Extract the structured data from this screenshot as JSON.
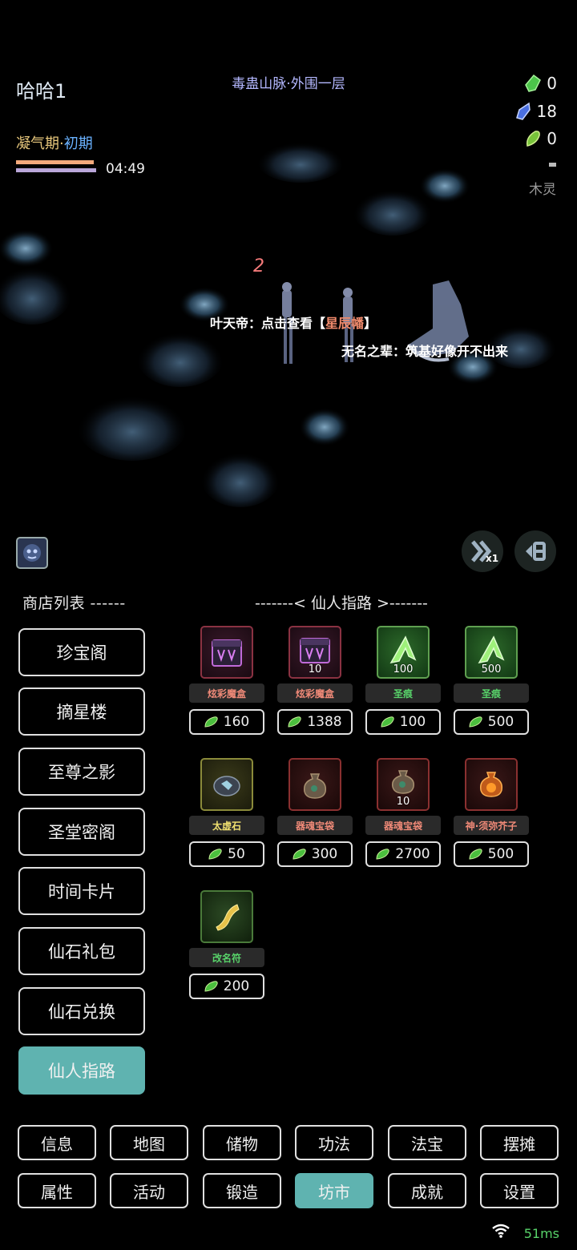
{
  "hud": {
    "player_name": "哈哈1",
    "location": "毒蛊山脉·外围一层",
    "realm": "凝气期",
    "realm_sep": "·",
    "realm_stage": "初期",
    "timer": "04:49",
    "currencies": [
      {
        "icon": "green-spirit-stone-icon",
        "value": "0"
      },
      {
        "icon": "blue-spirit-stone-icon",
        "value": "18"
      },
      {
        "icon": "green-leaf-stone-icon",
        "value": "0"
      }
    ],
    "spirit_root": "木灵"
  },
  "scene": {
    "damage_number": "2",
    "chat1_prefix": "叶天帝：点击查看【",
    "chat1_item": "星辰幡",
    "chat1_suffix": "】",
    "chat2": "无名之辈：筑基好像开不出来"
  },
  "controls": {
    "speed_label": "x1"
  },
  "shop": {
    "list_title": "商店列表 ------",
    "panel_title": "-------< 仙人指路 >-------",
    "shops": [
      "珍宝阁",
      "摘星楼",
      "至尊之影",
      "圣堂密阁",
      "时间卡片",
      "仙石礼包",
      "仙石兑换",
      "仙人指路"
    ],
    "active_shop": "仙人指路",
    "items": [
      {
        "name": "炫彩魔盒",
        "qty": "",
        "price": "160",
        "name_color": "#f08a78"
      },
      {
        "name": "炫彩魔盒",
        "qty": "10",
        "price": "1388",
        "name_color": "#f08a78"
      },
      {
        "name": "圣痕",
        "qty": "100",
        "price": "100",
        "name_color": "#58d36a"
      },
      {
        "name": "圣痕",
        "qty": "500",
        "price": "500",
        "name_color": "#58d36a"
      },
      {
        "name": "太虚石",
        "qty": "",
        "price": "50",
        "name_color": "#f0e070"
      },
      {
        "name": "器魂宝袋",
        "qty": "",
        "price": "300",
        "name_color": "#f08a78"
      },
      {
        "name": "器魂宝袋",
        "qty": "10",
        "price": "2700",
        "name_color": "#f08a78"
      },
      {
        "name": "神·须弥芥子",
        "qty": "",
        "price": "500",
        "name_color": "#f08a78"
      },
      {
        "name": "改名符",
        "qty": "",
        "price": "200",
        "name_color": "#58d36a"
      }
    ]
  },
  "nav": {
    "row1": [
      "信息",
      "地图",
      "储物",
      "功法",
      "法宝",
      "摆摊"
    ],
    "row2": [
      "属性",
      "活动",
      "锻造",
      "坊市",
      "成就",
      "设置"
    ],
    "active": "坊市"
  },
  "status": {
    "ping": "51ms"
  },
  "colors": {
    "accent": "#5fb3b0",
    "realm": "#e7c77c",
    "realm_stage": "#6ab2ff",
    "location": "#b4b8ff",
    "ping": "#58d36a"
  }
}
